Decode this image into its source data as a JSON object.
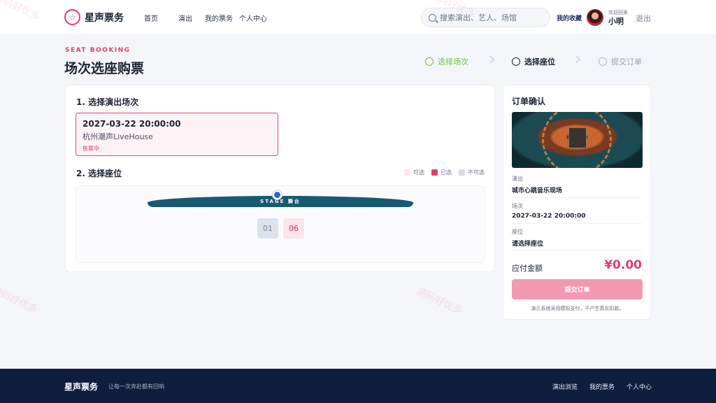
{
  "header": {
    "brand": "星声票务",
    "nav": [
      "首页",
      "演出",
      "我的票务",
      "个人中心"
    ],
    "search_placeholder": "搜索演出、艺人、场馆",
    "favorites": "我的收藏",
    "welcome": "欢迎回来",
    "user_name": "小明",
    "logout": "退出"
  },
  "page": {
    "eyebrow": "SEAT BOOKING",
    "title": "场次选座购票"
  },
  "steps": [
    {
      "label": "选择场次",
      "state": "done"
    },
    {
      "label": "选择座位",
      "state": "active"
    },
    {
      "label": "提交订单",
      "state": "pending"
    }
  ],
  "session_section": {
    "title": "1. 选择演出场次",
    "selected": {
      "time": "2027-03-22 20:00:00",
      "venue": "杭州潮声LiveHouse",
      "status": "售票中"
    }
  },
  "seat_section": {
    "title": "2. 选择座位",
    "legend": [
      {
        "label": "可选",
        "color": "#fde5ec"
      },
      {
        "label": "已选",
        "color": "#e23e6b"
      },
      {
        "label": "不可选",
        "color": "#d6dce6"
      }
    ],
    "stage_label": "STAGE 舞台",
    "seats": [
      "01",
      "06"
    ]
  },
  "order": {
    "title": "订单确认",
    "fields": [
      {
        "label": "演出",
        "value": "城市心跳音乐现场"
      },
      {
        "label": "场次",
        "value": "2027-03-22 20:00:00"
      },
      {
        "label": "座位",
        "value": "请选择座位"
      }
    ],
    "amount_label": "应付金额",
    "amount": "¥0.00",
    "submit_label": "提交订单",
    "note": "演示系统采用模拟支付，不产生真实扣款。"
  },
  "watermark": "源码好优多",
  "footer": {
    "brand": "星声票务",
    "slogan": "让每一次奔赴都有回响",
    "links": [
      "演出浏览",
      "我的票务",
      "个人中心"
    ]
  },
  "colors": {
    "accent": "#e23e6b",
    "done": "#6cc24a",
    "stage": "#185a72",
    "footer_bg": "#0f1e3c"
  }
}
